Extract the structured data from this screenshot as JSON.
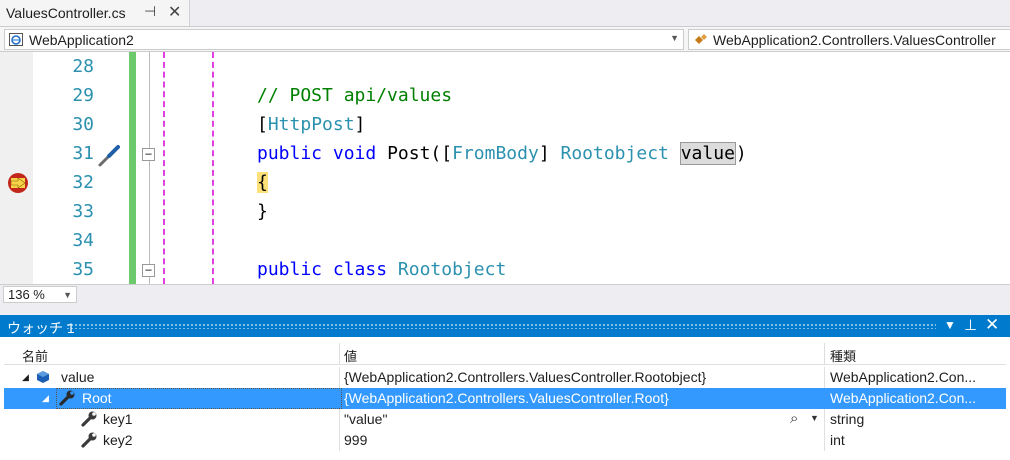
{
  "tab": {
    "title": "ValuesController.cs"
  },
  "nav": {
    "project": "WebApplication2",
    "class": "WebApplication2.Controllers.ValuesController"
  },
  "editor": {
    "line_numbers": [
      "28",
      "29",
      "30",
      "31",
      "32",
      "33",
      "34",
      "35"
    ],
    "lines": {
      "l29_comment": "// POST api/values",
      "l30_open": "[",
      "l30_attr": "HttpPost",
      "l30_close": "]",
      "l31_kw1": "public",
      "l31_kw2": "void",
      "l31_method": "Post([",
      "l31_attr": "FromBody",
      "l31_mid": "] ",
      "l31_type": "Rootobject",
      "l31_param": "value",
      "l31_end": ")",
      "l32_brace": "{",
      "l33_brace": "}",
      "l35_kw1": "public",
      "l35_kw2": "class",
      "l35_type": "Rootobject"
    },
    "breakpoint_line": "32"
  },
  "zoom": {
    "value": "136 %"
  },
  "watch": {
    "title": "ウォッチ 1",
    "columns": {
      "name": "名前",
      "value": "値",
      "type": "種類"
    },
    "rows": [
      {
        "name": "value",
        "value": "{WebApplication2.Controllers.ValuesController.Rootobject}",
        "type": "WebApplication2.Con..."
      },
      {
        "name": "Root",
        "value": "{WebApplication2.Controllers.ValuesController.Root}",
        "type": "WebApplication2.Con..."
      },
      {
        "name": "key1",
        "value": "\"value\"",
        "type": "string"
      },
      {
        "name": "key2",
        "value": "999",
        "type": "int"
      }
    ]
  },
  "colors": {
    "accent": "#007acc",
    "selection": "#3399ff",
    "change_bar": "#6cca6c",
    "breakpoint": "#c2271b"
  },
  "icons": [
    "pin-icon",
    "close-icon",
    "project-icon",
    "class-icon",
    "breakpoint-arrow-icon",
    "screwdriver-icon",
    "collapse-icon",
    "cube-icon",
    "wrench-icon",
    "magnifier-icon"
  ]
}
